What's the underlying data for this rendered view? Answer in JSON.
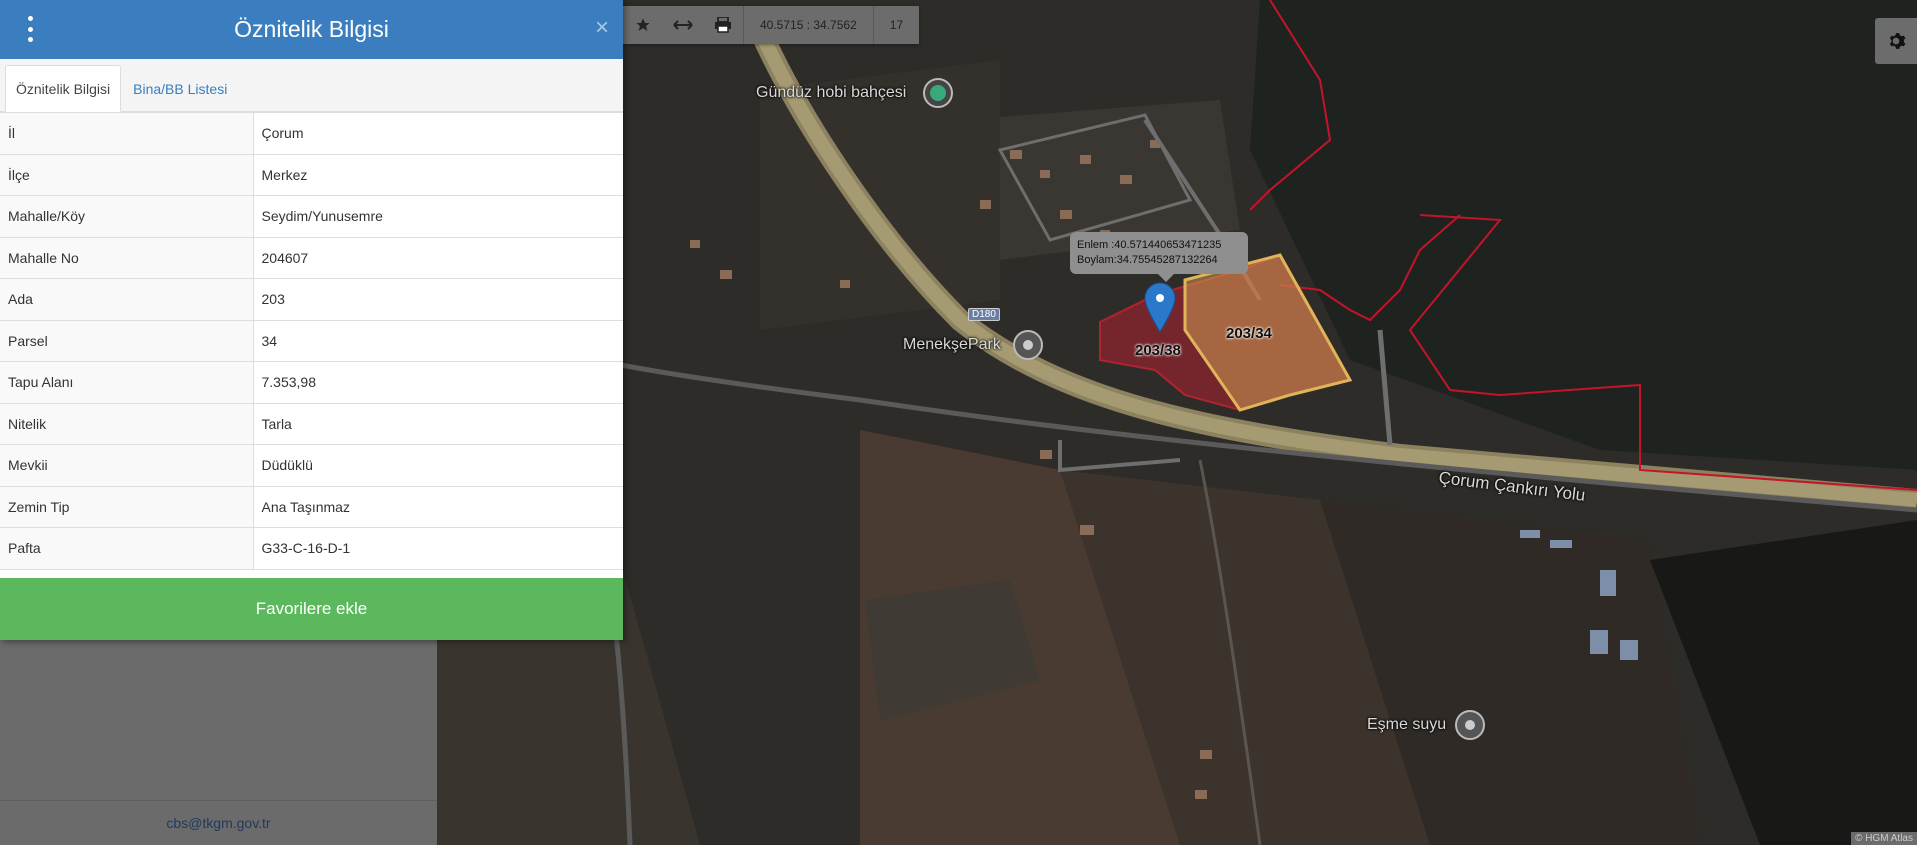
{
  "panel": {
    "title": "Öznitelik Bilgisi",
    "close_symbol": "×",
    "tabs": [
      {
        "label": "Öznitelik Bilgisi",
        "active": true
      },
      {
        "label": "Bina/BB Listesi",
        "active": false
      }
    ],
    "rows": [
      {
        "key": "İl",
        "value": "Çorum"
      },
      {
        "key": "İlçe",
        "value": "Merkez"
      },
      {
        "key": "Mahalle/Köy",
        "value": "Seydim/Yunusemre"
      },
      {
        "key": "Mahalle No",
        "value": "204607"
      },
      {
        "key": "Ada",
        "value": "203"
      },
      {
        "key": "Parsel",
        "value": "34"
      },
      {
        "key": "Tapu Alanı",
        "value": "7.353,98"
      },
      {
        "key": "Nitelik",
        "value": "Tarla"
      },
      {
        "key": "Mevkii",
        "value": "Düdüklü"
      },
      {
        "key": "Zemin Tip",
        "value": "Ana Taşınmaz"
      },
      {
        "key": "Pafta",
        "value": "G33-C-16-D-1"
      }
    ],
    "favorite_button": "Favorilere ekle"
  },
  "toolbar": {
    "coordinates": "40.5715 : 34.7562",
    "zoom": "17",
    "icons": [
      "star-icon",
      "measure-icon",
      "print-icon"
    ]
  },
  "sidebar": {
    "footer_email": "cbs@tkgm.gov.tr"
  },
  "map": {
    "labels": {
      "gunduz": "Gündüz hobi bahçesi",
      "menekse": "MenekşePark",
      "esme": "Eşme suyu",
      "road": "Çorum Çankırı Yolu",
      "d180": "D180"
    },
    "parcels": {
      "a": "203/38",
      "b": "203/34"
    },
    "tooltip": {
      "lat": "Enlem  :40.571440653471235",
      "lon": "Boylam:34.75545287132264"
    },
    "attribution": "© HGM Atlas"
  },
  "colors": {
    "header": "#3a7ebf",
    "favorite": "#5cb85c",
    "parcel_selected": "#e0b55a",
    "parcel_neighbor": "#b0232f",
    "boundary": "#c4142a"
  }
}
